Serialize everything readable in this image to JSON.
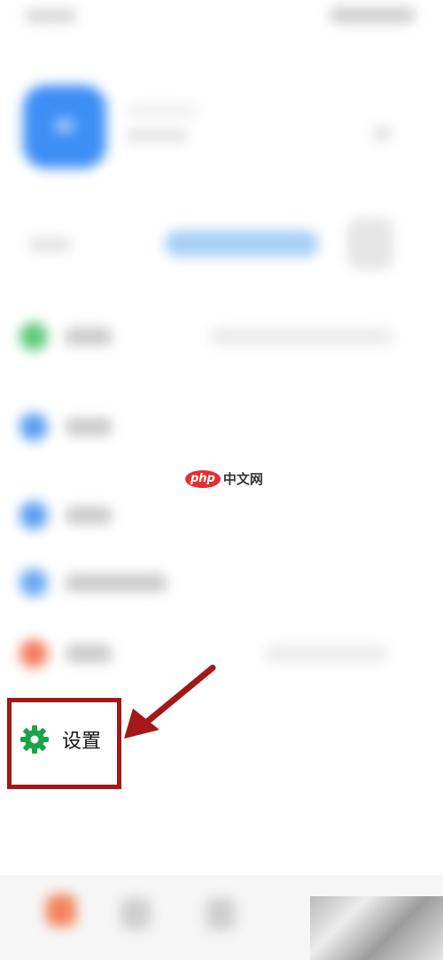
{
  "watermark": {
    "badge": "php",
    "text": "中文网"
  },
  "settings": {
    "label": "设置"
  },
  "colors": {
    "accent_blue": "#3d8ef5",
    "highlight_red": "#a31818",
    "gear_green": "#1aa34a"
  },
  "icons": {
    "settings": "gear-icon",
    "pointer": "arrow-icon"
  }
}
